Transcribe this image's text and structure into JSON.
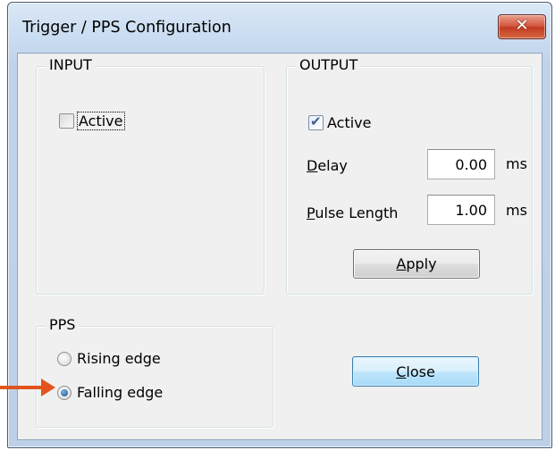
{
  "window": {
    "title": "Trigger / PPS Configuration",
    "close_glyph": "✕"
  },
  "input_group": {
    "legend": "INPUT",
    "active_label": "Active",
    "active_checked": false
  },
  "output_group": {
    "legend": "OUTPUT",
    "active_label": "Active",
    "active_checked": true,
    "delay": {
      "label_underlined": "D",
      "label_rest": "elay",
      "value": "0.00",
      "unit": "ms"
    },
    "pulse_length": {
      "label_underlined": "P",
      "label_rest": "ulse Length",
      "value": "1.00",
      "unit": "ms"
    },
    "apply_button": {
      "label_underlined": "A",
      "label_rest": "pply"
    }
  },
  "pps_group": {
    "legend": "PPS",
    "options": [
      {
        "label": "Rising edge",
        "selected": false
      },
      {
        "label": "Falling edge",
        "selected": true
      }
    ]
  },
  "close_button": {
    "label_underlined": "C",
    "label_rest": "lose"
  },
  "annotation": {
    "color": "#e1541d"
  }
}
